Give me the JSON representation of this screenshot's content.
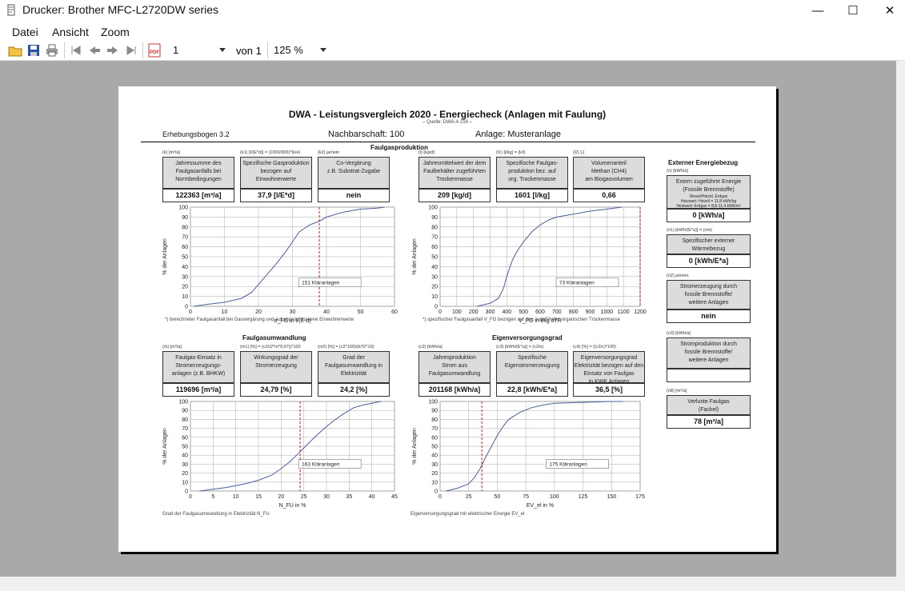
{
  "window": {
    "title": "Drucker:  Brother MFC-L2720DW series",
    "minimize": "—",
    "maximize": "☐",
    "close": "✕"
  },
  "menu": [
    "Datei",
    "Ansicht",
    "Zoom"
  ],
  "toolbar": {
    "page_value": "1",
    "page_total": "von 1",
    "zoom": "125 %",
    "pdf_label": "PDF"
  },
  "doc": {
    "title": "DWA - Leistungsvergleich 2020     -     Energiecheck   (Anlagen mit Faulung)",
    "quelle": "– Quelle: DWA-A 216 –",
    "bogen": "Erhebungsbogen  3.2",
    "nachbarschaft": "Nachbarschaft: 100",
    "anlage": "Anlage: Musteranlage",
    "sec_prod": "Faulgasproduktion",
    "sec_umw": "Faulgasumwandlung",
    "sec_eigen": "Eigenversorgungsgrad",
    "sec_extern": "Externer Energiebezug",
    "prod_boxes": [
      {
        "code": "(k)    [m³/a]",
        "text": [
          "Jahressumme des",
          "Faulgasanfalls bei",
          "Normbedingungen"
        ],
        "value": "122363  [m³/a]"
      },
      {
        "code": "(k1)    [l/(E*d)] = (1000/365)*(k/e)",
        "text": [
          "Spezifische Gasproduktion",
          "bezogen auf",
          "Einwohnerwerte"
        ],
        "value": "37,9  [l/E*d]"
      },
      {
        "code": "(k2)    ja/nein",
        "text": [
          "Co-Vergärung",
          "z.B. Substrat-Zugabe"
        ],
        "value": "nein"
      },
      {
        "code": "(l)    [kg/d]",
        "text": [
          "Jahresmittelwert der dem",
          "Faulbehälter zugeführten",
          "Trockenmasse"
        ],
        "value": "209  [kg/d]"
      },
      {
        "code": "(l1)    [l/kg] = (k/l)",
        "text": [
          "Spezifische Faulgas-",
          "produktion bez. auf",
          "org. Trockenmasse"
        ],
        "value": "1601  [l/kg]"
      },
      {
        "code": "(l2)    [-]",
        "text": [
          "Volumenanteil",
          "Methan (CH4)",
          "am Biogasvolumen"
        ],
        "value": "0,66"
      }
    ],
    "umw_boxes": [
      {
        "code": "(m)    [m³/a]",
        "text": [
          "Faulgas-Einsatz in",
          "Stromerzeugungs-",
          "anlagen (z.B. BHKW)"
        ],
        "value": "119696  [m³/a]"
      },
      {
        "code": "(m1)    [%] = (c2/(2*m*9,97))*100",
        "text": [
          "Wirkungsgrad der",
          "Stromerzeugung"
        ],
        "value": "24,79  [%]"
      },
      {
        "code": "(m2)    [%] = (c2*100)/(k*l2*10)",
        "text": [
          "Grad der",
          "Faulgasumwandlung in",
          "Elektrizität"
        ],
        "value": "24,2  [%]"
      },
      {
        "code": "(c2)    [kWh/a]",
        "text": [
          "Jahresproduktion",
          "Strom aus",
          "Faulgasumwandlung"
        ],
        "value": "201168  [kWh/a]"
      },
      {
        "code": "(c3)    [kWh/(E*a)] = (c2/e)",
        "text": [
          "Spezifische",
          "Eigenstromerzeugung"
        ],
        "value": "22,8  [kWh/E*a]"
      },
      {
        "code": "(c4)    [%] = ((c2/c)*100)",
        "text": [
          "Eigenversorgungsgrad",
          "Elektrizität bezogen auf den",
          "Einsatz von Faulgas",
          "in KWK Anlagen"
        ],
        "value": "36,5  [%]"
      }
    ],
    "extern_boxes": [
      {
        "code": "(n)    [kWh/a]",
        "text": [
          "Extern zugeführte Energie",
          "(Fossile Brennstoffe)",
          "Diesel/Heizöl, Erdgas",
          "Heizwert: Heizöl = 11,8 kWh/kg",
          "Heizwert: Erdgas = 8,8-11,4 kWh/m³"
        ],
        "value": "0  [kWh/a]"
      },
      {
        "code": "(n1)    [kWh/(E*a)] = (n/e)",
        "text": [
          "Spezifischer externer",
          "Wärmebezug"
        ],
        "value": "0  [kWh/E*a]"
      },
      {
        "code": "(n2)    ja/nein",
        "text": [
          "Stromerzeugung durch",
          "fossile Brennstoffe/",
          "weitere Anlagen"
        ],
        "value": "nein"
      },
      {
        "code": "(n3)    [kWh/a]",
        "text": [
          "Stromproduktion durch",
          "fossile Brennstoffe/",
          "weitere Anlagen"
        ],
        "value": ""
      },
      {
        "code": "(n8)    [m³/a]",
        "text": [
          "Verluste Faulgas",
          "(Fackel)"
        ],
        "value": "78  [m³/a]"
      }
    ],
    "foot1": "*) berechneter Faulgasanfall bei Gasvergärung und auf angeschlossene Einwohnerwerte",
    "foot2": "*) spezifischer Faulgasanfall V_FG bezogen auf den zugeführten organischen Trockenmasse",
    "foot3": "Grad der Faulgasumwandlung in Elektrizität N_FU",
    "foot4": "Eigenversorgungsgrad mit elektrischer Energie EV_el"
  },
  "chart_data": [
    {
      "type": "line",
      "ylabel": "% der Anlagen",
      "xlabel": "σ_FG in l/(E·d)",
      "xlim": [
        0,
        60
      ],
      "ylim": [
        0,
        100
      ],
      "xticks": [
        "0",
        "10",
        "20",
        "30",
        "40",
        "50",
        "60"
      ],
      "yticks": [
        "0",
        "10",
        "20",
        "30",
        "40",
        "50",
        "60",
        "70",
        "80",
        "90",
        "100"
      ],
      "x": [
        1,
        5,
        10,
        15,
        18,
        20,
        22,
        25,
        28,
        30,
        32,
        35,
        38,
        40,
        45,
        50,
        55,
        57
      ],
      "y": [
        0,
        2,
        4,
        8,
        14,
        22,
        30,
        42,
        55,
        65,
        75,
        82,
        86,
        90,
        95,
        98,
        99,
        100
      ],
      "marker": 37.9,
      "annotation": "151 Kläranlagen"
    },
    {
      "type": "line",
      "ylabel": "% der Anlagen",
      "xlabel": "V_FG in l/kg oTR",
      "xlim": [
        0,
        1200
      ],
      "ylim": [
        0,
        100
      ],
      "xticks": [
        "0",
        "100",
        "200",
        "300",
        "400",
        "500",
        "600",
        "700",
        "800",
        "900",
        "1000",
        "1100",
        "1200"
      ],
      "yticks": [
        "0",
        "10",
        "20",
        "30",
        "40",
        "50",
        "60",
        "70",
        "80",
        "90",
        "100"
      ],
      "x": [
        220,
        300,
        350,
        380,
        400,
        430,
        460,
        500,
        550,
        600,
        650,
        700,
        800,
        900,
        1000,
        1090
      ],
      "y": [
        0,
        3,
        8,
        18,
        30,
        45,
        55,
        65,
        75,
        82,
        87,
        90,
        93,
        96,
        98,
        100
      ],
      "marker": 1601,
      "annotation": "73 Kläranlagen"
    },
    {
      "type": "line",
      "ylabel": "% der Anlagen",
      "xlabel": "N_FU in %",
      "xlim": [
        0,
        45
      ],
      "ylim": [
        0,
        100
      ],
      "xticks": [
        "0",
        "5",
        "10",
        "15",
        "20",
        "25",
        "30",
        "35",
        "40",
        "45"
      ],
      "yticks": [
        "0",
        "10",
        "20",
        "30",
        "40",
        "50",
        "60",
        "70",
        "80",
        "90",
        "100"
      ],
      "x": [
        2,
        5,
        8,
        12,
        15,
        18,
        20,
        22,
        24,
        26,
        28,
        30,
        32,
        34,
        36,
        38,
        40,
        42
      ],
      "y": [
        0,
        2,
        4,
        8,
        12,
        18,
        25,
        33,
        43,
        53,
        63,
        72,
        80,
        87,
        93,
        96,
        98,
        100
      ],
      "marker": 24.2,
      "annotation": "163 Kläranlagen"
    },
    {
      "type": "line",
      "ylabel": "% der Anlagen",
      "xlabel": "EV_el in %",
      "xlim": [
        0,
        175
      ],
      "ylim": [
        0,
        100
      ],
      "xticks": [
        "0",
        "25",
        "50",
        "75",
        "100",
        "125",
        "150",
        "175"
      ],
      "yticks": [
        "0",
        "10",
        "20",
        "30",
        "40",
        "50",
        "60",
        "70",
        "80",
        "90",
        "100"
      ],
      "x": [
        5,
        15,
        25,
        30,
        35,
        40,
        45,
        50,
        55,
        60,
        70,
        80,
        90,
        100,
        125,
        150,
        160
      ],
      "y": [
        0,
        3,
        8,
        15,
        25,
        38,
        50,
        62,
        72,
        80,
        88,
        93,
        96,
        98,
        99,
        100,
        100
      ],
      "marker": 36.5,
      "annotation": "175 Kläranlagen"
    }
  ]
}
